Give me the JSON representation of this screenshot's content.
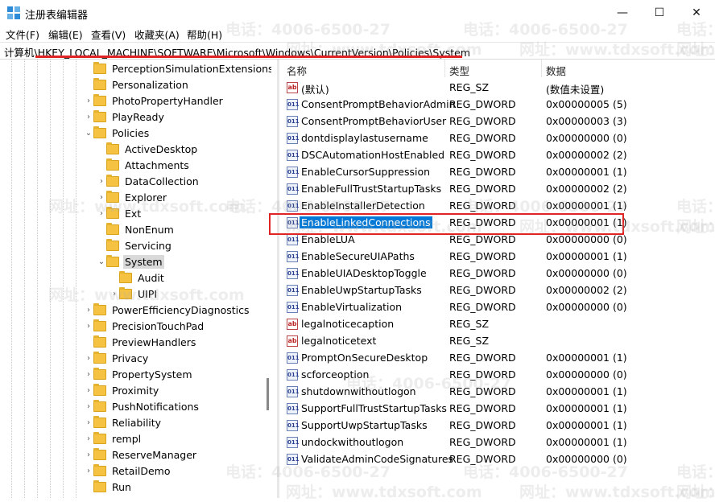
{
  "window": {
    "title": "注册表编辑器",
    "minimize_glyph": "—",
    "maximize_glyph": "☐",
    "close_glyph": "✕"
  },
  "menu": [
    "文件(F)",
    "编辑(E)",
    "查看(V)",
    "收藏夹(A)",
    "帮助(H)"
  ],
  "address": "计算机\\HKEY_LOCAL_MACHINE\\SOFTWARE\\Microsoft\\Windows\\CurrentVersion\\Policies\\System",
  "tree": [
    {
      "label": "PerceptionSimulationExtensions",
      "expander": ""
    },
    {
      "label": "Personalization",
      "expander": ""
    },
    {
      "label": "PhotoPropertyHandler",
      "expander": ">"
    },
    {
      "label": "PlayReady",
      "expander": ">"
    },
    {
      "label": "Policies",
      "expander": "v"
    },
    {
      "label": "ActiveDesktop",
      "expander": ""
    },
    {
      "label": "Attachments",
      "expander": ""
    },
    {
      "label": "DataCollection",
      "expander": ">"
    },
    {
      "label": "Explorer",
      "expander": ">"
    },
    {
      "label": "Ext",
      "expander": ">"
    },
    {
      "label": "NonEnum",
      "expander": ""
    },
    {
      "label": "Servicing",
      "expander": ""
    },
    {
      "label": "System",
      "expander": "v"
    },
    {
      "label": "Audit",
      "expander": ""
    },
    {
      "label": "UIPI",
      "expander": ">"
    },
    {
      "label": "PowerEfficiencyDiagnostics",
      "expander": ">"
    },
    {
      "label": "PrecisionTouchPad",
      "expander": ">"
    },
    {
      "label": "PreviewHandlers",
      "expander": ""
    },
    {
      "label": "Privacy",
      "expander": ">"
    },
    {
      "label": "PropertySystem",
      "expander": ">"
    },
    {
      "label": "Proximity",
      "expander": ">"
    },
    {
      "label": "PushNotifications",
      "expander": ">"
    },
    {
      "label": "Reliability",
      "expander": ">"
    },
    {
      "label": "rempl",
      "expander": ">"
    },
    {
      "label": "ReserveManager",
      "expander": ">"
    },
    {
      "label": "RetailDemo",
      "expander": ">"
    },
    {
      "label": "Run",
      "expander": ""
    }
  ],
  "columns": {
    "name": "名称",
    "type": "类型",
    "data": "数据"
  },
  "values": [
    {
      "name": "(默认)",
      "type": "REG_SZ",
      "data": "(数值未设置)",
      "icon": "ab"
    },
    {
      "name": "ConsentPromptBehaviorAdmin",
      "type": "REG_DWORD",
      "data": "0x00000005 (5)",
      "icon": "011"
    },
    {
      "name": "ConsentPromptBehaviorUser",
      "type": "REG_DWORD",
      "data": "0x00000003 (3)",
      "icon": "011"
    },
    {
      "name": "dontdisplaylastusername",
      "type": "REG_DWORD",
      "data": "0x00000000 (0)",
      "icon": "011"
    },
    {
      "name": "DSCAutomationHostEnabled",
      "type": "REG_DWORD",
      "data": "0x00000002 (2)",
      "icon": "011"
    },
    {
      "name": "EnableCursorSuppression",
      "type": "REG_DWORD",
      "data": "0x00000001 (1)",
      "icon": "011"
    },
    {
      "name": "EnableFullTrustStartupTasks",
      "type": "REG_DWORD",
      "data": "0x00000002 (2)",
      "icon": "011"
    },
    {
      "name": "EnableInstallerDetection",
      "type": "REG_DWORD",
      "data": "0x00000001 (1)",
      "icon": "011"
    },
    {
      "name": "EnableLinkedConnections",
      "type": "REG_DWORD",
      "data": "0x00000001 (1)",
      "icon": "011"
    },
    {
      "name": "EnableLUA",
      "type": "REG_DWORD",
      "data": "0x00000000 (0)",
      "icon": "011"
    },
    {
      "name": "EnableSecureUIAPaths",
      "type": "REG_DWORD",
      "data": "0x00000001 (1)",
      "icon": "011"
    },
    {
      "name": "EnableUIADesktopToggle",
      "type": "REG_DWORD",
      "data": "0x00000000 (0)",
      "icon": "011"
    },
    {
      "name": "EnableUwpStartupTasks",
      "type": "REG_DWORD",
      "data": "0x00000002 (2)",
      "icon": "011"
    },
    {
      "name": "EnableVirtualization",
      "type": "REG_DWORD",
      "data": "0x00000000 (0)",
      "icon": "011"
    },
    {
      "name": "legalnoticecaption",
      "type": "REG_SZ",
      "data": "",
      "icon": "ab"
    },
    {
      "name": "legalnoticetext",
      "type": "REG_SZ",
      "data": "",
      "icon": "ab"
    },
    {
      "name": "PromptOnSecureDesktop",
      "type": "REG_DWORD",
      "data": "0x00000001 (1)",
      "icon": "011"
    },
    {
      "name": "scforceoption",
      "type": "REG_DWORD",
      "data": "0x00000000 (0)",
      "icon": "011"
    },
    {
      "name": "shutdownwithoutlogon",
      "type": "REG_DWORD",
      "data": "0x00000001 (1)",
      "icon": "011"
    },
    {
      "name": "SupportFullTrustStartupTasks",
      "type": "REG_DWORD",
      "data": "0x00000001 (1)",
      "icon": "011"
    },
    {
      "name": "SupportUwpStartupTasks",
      "type": "REG_DWORD",
      "data": "0x00000001 (1)",
      "icon": "011"
    },
    {
      "name": "undockwithoutlogon",
      "type": "REG_DWORD",
      "data": "0x00000001 (1)",
      "icon": "011"
    },
    {
      "name": "ValidateAdminCodeSignatures",
      "type": "REG_DWORD",
      "data": "0x00000000 (0)",
      "icon": "011"
    }
  ],
  "selected_value": "EnableLinkedConnections",
  "selected_key": "System",
  "watermarks": [
    "电话：4006-6500-27",
    "网址：www.tdxsoft.com",
    "电话：",
    "网址："
  ],
  "colors": {
    "selection": "#0078d7",
    "annotation": "#e02424",
    "folder": "#f5c242"
  }
}
